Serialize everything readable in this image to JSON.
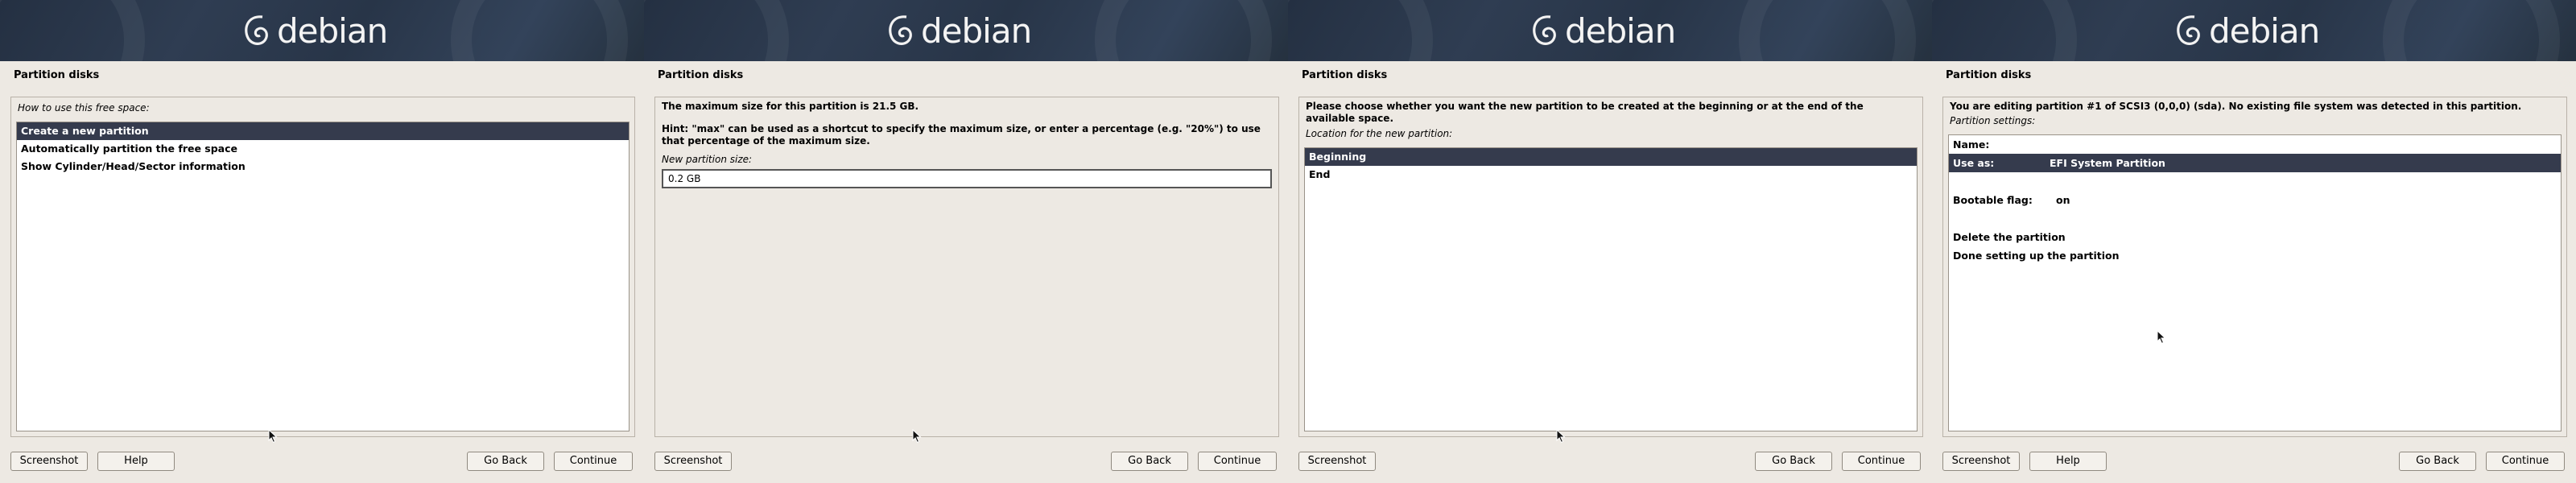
{
  "brand": {
    "logo_text": "debian"
  },
  "buttons": {
    "screenshot": "Screenshot",
    "help": "Help",
    "go_back": "Go Back",
    "continue": "Continue"
  },
  "panels": [
    {
      "title": "Partition disks",
      "question": "How to use this free space:",
      "options": [
        "Create a new partition",
        "Automatically partition the free space",
        "Show Cylinder/Head/Sector information"
      ],
      "selected_index": 0
    },
    {
      "title": "Partition disks",
      "info": "The maximum size for this partition is 21.5 GB.",
      "hint": "Hint: \"max\" can be used as a shortcut to specify the maximum size, or enter a percentage (e.g. \"20%\") to use that percentage of the maximum size.",
      "question": "New partition size:",
      "input_value": "0.2 GB"
    },
    {
      "title": "Partition disks",
      "info": "Please choose whether you want the new partition to be created at the beginning or at the end of the available space.",
      "question": "Location for the new partition:",
      "options": [
        "Beginning",
        "End"
      ],
      "selected_index": 0
    },
    {
      "title": "Partition disks",
      "info": "You are editing partition #1 of SCSI3 (0,0,0) (sda). No existing file system was detected in this partition.",
      "question": "Partition settings:",
      "settings": [
        {
          "key": "Name:",
          "value": ""
        },
        {
          "key": "Use as:",
          "value": "EFI System Partition"
        },
        {
          "key": "Bootable flag:",
          "value": "on"
        },
        {
          "key": "Delete the partition",
          "value": ""
        },
        {
          "key": "Done setting up the partition",
          "value": ""
        }
      ],
      "selected_index": 1
    }
  ]
}
